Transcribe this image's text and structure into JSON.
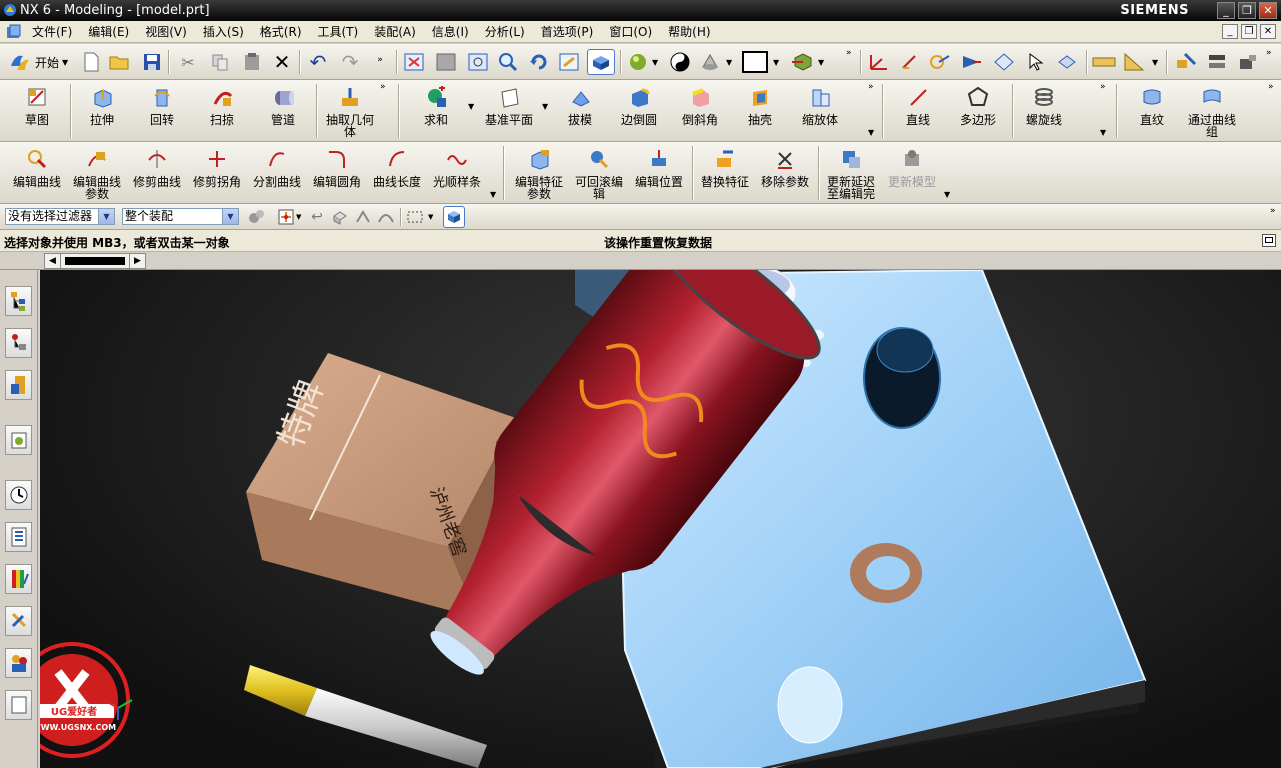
{
  "window": {
    "title": "NX 6 - Modeling - [model.prt]",
    "brand": "SIEMENS"
  },
  "menu": [
    "文件(F)",
    "编辑(E)",
    "视图(V)",
    "插入(S)",
    "格式(R)",
    "工具(T)",
    "装配(A)",
    "信息(I)",
    "分析(L)",
    "首选项(P)",
    "窗口(O)",
    "帮助(H)"
  ],
  "standard_toolbar": {
    "start_label": "开始"
  },
  "form_features": {
    "items": [
      {
        "label": "草图",
        "icon": "sketch-icon"
      },
      {
        "label": "拉伸",
        "icon": "extrude-icon"
      },
      {
        "label": "回转",
        "icon": "revolve-icon"
      },
      {
        "label": "扫掠",
        "icon": "sweep-icon"
      },
      {
        "label": "管道",
        "icon": "tube-icon"
      },
      {
        "label": "抽取几何体",
        "icon": "extract-geometry-icon"
      },
      {
        "label": "求和",
        "icon": "unite-icon"
      },
      {
        "label": "基准平面",
        "icon": "datum-plane-icon"
      },
      {
        "label": "拔模",
        "icon": "draft-icon"
      },
      {
        "label": "边倒圆",
        "icon": "edge-blend-icon"
      },
      {
        "label": "倒斜角",
        "icon": "chamfer-icon"
      },
      {
        "label": "抽壳",
        "icon": "shell-icon"
      },
      {
        "label": "缩放体",
        "icon": "scale-body-icon"
      },
      {
        "label": "直线",
        "icon": "line-icon"
      },
      {
        "label": "多边形",
        "icon": "polygon-icon"
      },
      {
        "label": "螺旋线",
        "icon": "helix-icon"
      },
      {
        "label": "直纹",
        "icon": "ruled-icon"
      },
      {
        "label": "通过曲线组",
        "icon": "through-curves-icon"
      }
    ]
  },
  "edit_features": {
    "items": [
      {
        "label": "编辑曲线",
        "icon": "edit-curve-icon"
      },
      {
        "label": "编辑曲线参数",
        "icon": "edit-curve-params-icon"
      },
      {
        "label": "修剪曲线",
        "icon": "trim-curve-icon"
      },
      {
        "label": "修剪拐角",
        "icon": "trim-corner-icon"
      },
      {
        "label": "分割曲线",
        "icon": "divide-curve-icon"
      },
      {
        "label": "编辑圆角",
        "icon": "edit-fillet-icon"
      },
      {
        "label": "曲线长度",
        "icon": "curve-length-icon"
      },
      {
        "label": "光顺样条",
        "icon": "smooth-spline-icon"
      },
      {
        "label": "编辑特征参数",
        "icon": "edit-feature-params-icon"
      },
      {
        "label": "可回滚编辑",
        "icon": "rollback-edit-icon"
      },
      {
        "label": "编辑位置",
        "icon": "edit-position-icon"
      },
      {
        "label": "替换特征",
        "icon": "replace-feature-icon"
      },
      {
        "label": "移除参数",
        "icon": "remove-params-icon"
      },
      {
        "label": "更新延迟至编辑完",
        "icon": "delay-update-icon"
      },
      {
        "label": "更新模型",
        "icon": "update-model-icon",
        "disabled": true
      }
    ]
  },
  "selection_bar": {
    "filter": "没有选择过滤器",
    "scope": "整个装配"
  },
  "status": {
    "prompt": "选择对象并使用 MB3，或者双击某一对象",
    "message": "该操作重置恢复数据"
  },
  "viewport": {
    "bottle_color": "#8a1420",
    "box_text_top": "特牌",
    "box_text_side": "泸州老窖",
    "watermark_text": "UG爱好者",
    "watermark_url": "WWW.UGSNX.COM"
  }
}
